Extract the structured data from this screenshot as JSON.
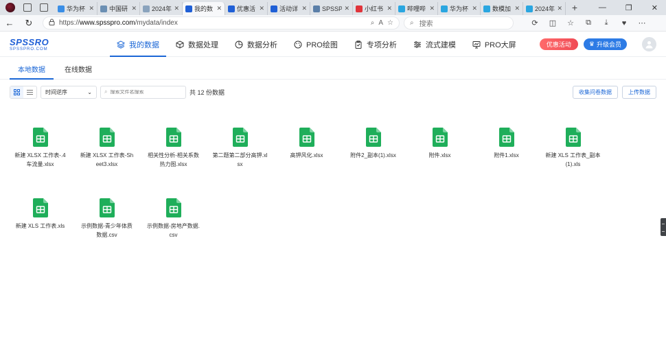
{
  "browser": {
    "tabs": [
      {
        "label": "华为杯",
        "color": "#3a8ee6",
        "icon": "page-icon"
      },
      {
        "label": "中国研",
        "color": "#6b8fb3",
        "icon": "page-icon"
      },
      {
        "label": "2024年",
        "color": "#8aa3bd",
        "icon": "page-icon"
      },
      {
        "label": "我的数",
        "color": "#1f5fd6",
        "icon": "spsspro-icon",
        "active": true
      },
      {
        "label": "优惠活",
        "color": "#1f5fd6",
        "icon": "spsspro-icon"
      },
      {
        "label": "活动详",
        "color": "#1f5fd6",
        "icon": "spsspro-icon"
      },
      {
        "label": "SPSSP",
        "color": "#5b7fa8",
        "icon": "shield-icon"
      },
      {
        "label": "小红书",
        "color": "#e0343b",
        "icon": "xiaohongshu-icon"
      },
      {
        "label": "哔哩哔",
        "color": "#2aa6e0",
        "icon": "bilibili-icon"
      },
      {
        "label": "华为杯",
        "color": "#2aa6e0",
        "icon": "bilibili-icon"
      },
      {
        "label": "数模加",
        "color": "#2aa6e0",
        "icon": "bilibili-icon"
      },
      {
        "label": "2024年",
        "color": "#2aa6e0",
        "icon": "bilibili-icon"
      }
    ],
    "url_prefix": "https://",
    "url_domain": "www.spsspro.com",
    "url_path": "/mydata/index",
    "search_placeholder": "搜索",
    "new_tab": "+",
    "win_min": "—",
    "win_max": "❐",
    "win_close": "✕"
  },
  "app": {
    "logo_main": "SPSSRO",
    "logo_sub": "SPSSPRO.COM",
    "nav": [
      {
        "label": "我的数据",
        "icon": "layers-icon",
        "active": true
      },
      {
        "label": "数据处理",
        "icon": "cube-icon"
      },
      {
        "label": "数据分析",
        "icon": "pie-icon"
      },
      {
        "label": "PRO绘图",
        "icon": "paint-icon"
      },
      {
        "label": "专项分析",
        "icon": "clipboard-icon"
      },
      {
        "label": "流式建模",
        "icon": "sliders-icon"
      },
      {
        "label": "PRO大屏",
        "icon": "monitor-icon"
      }
    ],
    "promo_label": "优惠活动",
    "vip_label": "升级会员"
  },
  "subtabs": [
    {
      "label": "本地数据",
      "active": true
    },
    {
      "label": "在线数据"
    }
  ],
  "toolbar": {
    "sort_label": "时间逆序",
    "search_placeholder": "搜索文件名搜索",
    "count_label": "共 12 份数据",
    "collect_label": "收集问卷数据",
    "upload_label": "上传数据"
  },
  "files": [
    {
      "name": "新建 XLSX 工作表-.4车流量.xlsx"
    },
    {
      "name": "新建 XLSX 工作表-Sheet3.xlsx"
    },
    {
      "name": "相关性分析-相关系数热力图.xlsx"
    },
    {
      "name": "第二题第二部分高钾.xlsx"
    },
    {
      "name": "高钾风化.xlsx"
    },
    {
      "name": "附件2_副本(1).xlsx"
    },
    {
      "name": "附件.xlsx"
    },
    {
      "name": "附件1.xlsx"
    },
    {
      "name": "新建 XLS 工作表_副本(1).xls"
    },
    {
      "name": "新建 XLS 工作表.xls"
    },
    {
      "name": "示例数据-青少年体质数据.csv"
    },
    {
      "name": "示例数据-房地产数据.csv"
    }
  ],
  "colors": {
    "accent": "#1a66d6",
    "file_green": "#1fae5a",
    "promo_red": "#f04a55",
    "vip_blue": "#2d7be5"
  }
}
